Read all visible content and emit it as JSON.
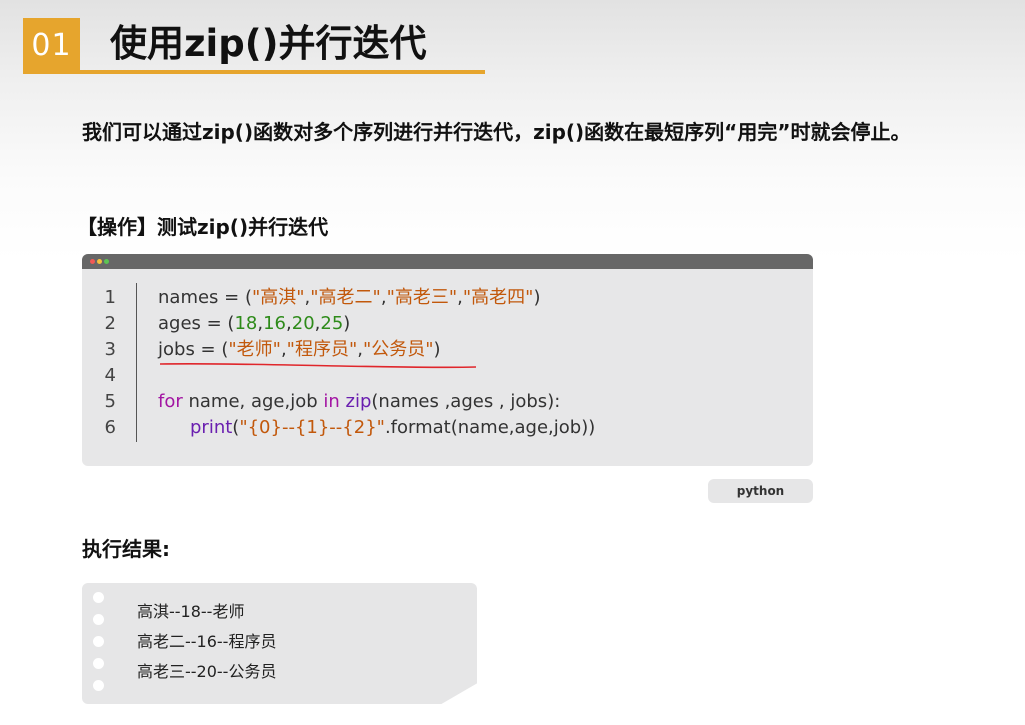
{
  "header": {
    "number": "01",
    "title": "使用zip()并行迭代",
    "accent_color": "#e6a52d"
  },
  "intro": "我们可以通过zip()函数对多个序列进行并行迭代，zip()函数在最短序列“用完”时就会停止。",
  "operation_label": "【操作】测试zip()并行迭代",
  "code_block": {
    "lines": [
      {
        "number": "1",
        "segments": [
          {
            "text": "names = (",
            "kind": "plain"
          },
          {
            "text": "\"高淇\"",
            "kind": "str"
          },
          {
            "text": ",",
            "kind": "plain"
          },
          {
            "text": "\"高老二\"",
            "kind": "str"
          },
          {
            "text": ",",
            "kind": "plain"
          },
          {
            "text": "\"高老三\"",
            "kind": "str"
          },
          {
            "text": ",",
            "kind": "plain"
          },
          {
            "text": "\"高老四\"",
            "kind": "str"
          },
          {
            "text": ")",
            "kind": "plain"
          }
        ]
      },
      {
        "number": "2",
        "segments": [
          {
            "text": "ages = (",
            "kind": "plain"
          },
          {
            "text": "18",
            "kind": "num"
          },
          {
            "text": ",",
            "kind": "plain"
          },
          {
            "text": "16",
            "kind": "num"
          },
          {
            "text": ",",
            "kind": "plain"
          },
          {
            "text": "20",
            "kind": "num"
          },
          {
            "text": ",",
            "kind": "plain"
          },
          {
            "text": "25",
            "kind": "num"
          },
          {
            "text": ")",
            "kind": "plain"
          }
        ]
      },
      {
        "number": "3",
        "segments": [
          {
            "text": "jobs = (",
            "kind": "plain"
          },
          {
            "text": "\"老师\"",
            "kind": "str"
          },
          {
            "text": ",",
            "kind": "plain"
          },
          {
            "text": "\"程序员\"",
            "kind": "str"
          },
          {
            "text": ",",
            "kind": "plain"
          },
          {
            "text": "\"公务员\"",
            "kind": "str"
          },
          {
            "text": ")",
            "kind": "plain"
          }
        ]
      },
      {
        "number": "4",
        "segments": []
      },
      {
        "number": "5",
        "segments": [
          {
            "text": "for",
            "kind": "kw"
          },
          {
            "text": " name, age,job ",
            "kind": "plain"
          },
          {
            "text": "in",
            "kind": "kw"
          },
          {
            "text": " ",
            "kind": "plain"
          },
          {
            "text": "zip",
            "kind": "fn"
          },
          {
            "text": "(names ,ages , jobs):",
            "kind": "plain"
          }
        ]
      },
      {
        "number": "6",
        "indent": true,
        "segments": [
          {
            "text": "print",
            "kind": "fn"
          },
          {
            "text": "(",
            "kind": "plain"
          },
          {
            "text": "\"{0}--{1}--{2}\"",
            "kind": "str"
          },
          {
            "text": ".format(name,age,job))",
            "kind": "plain"
          }
        ]
      }
    ],
    "language_tag": "python",
    "colors": {
      "string": "#c2580b",
      "number": "#2e8b1a",
      "keyword": "#a316a3",
      "function": "#6a1fb0",
      "underline": "#e0262b"
    }
  },
  "result": {
    "label": "执行结果:",
    "lines": [
      "高淇--18--老师",
      "高老二--16--程序员",
      "高老三--20--公务员"
    ]
  }
}
